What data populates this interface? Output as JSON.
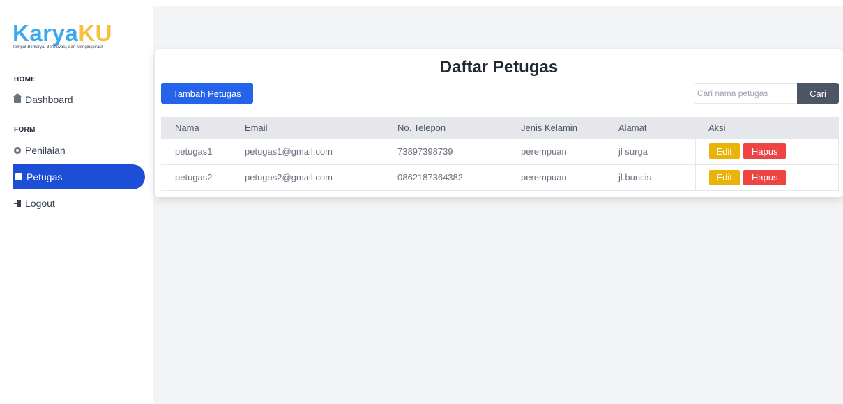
{
  "brand": {
    "name_part1": "Karya",
    "name_part2": "KU",
    "tagline": "Tempat Berkarya, Berinovasi, dan Menginspirasi!"
  },
  "sidebar": {
    "sections": [
      {
        "label": "HOME",
        "items": [
          {
            "label": "Dashboard",
            "icon": "home-icon"
          }
        ]
      },
      {
        "label": "FORM",
        "items": [
          {
            "label": "Penilaian",
            "icon": "gear-icon"
          },
          {
            "label": "Petugas",
            "icon": "document-icon",
            "active": true
          },
          {
            "label": "Logout",
            "icon": "logout-icon"
          }
        ]
      }
    ]
  },
  "page": {
    "title": "Daftar Petugas",
    "add_button": "Tambah Petugas",
    "search": {
      "placeholder": "Cari nama petugas",
      "button": "Cari"
    }
  },
  "table": {
    "columns": [
      "Nama",
      "Email",
      "No. Telepon",
      "Jenis Kelamin",
      "Alamat",
      "Aksi"
    ],
    "rows": [
      {
        "nama": "petugas1",
        "email": "petugas1@gmail.com",
        "telepon": "73897398739",
        "jenis_kelamin": "perempuan",
        "alamat": "jl surga"
      },
      {
        "nama": "petugas2",
        "email": "petugas2@gmail.com",
        "telepon": "0862187364382",
        "jenis_kelamin": "perempuan",
        "alamat": "jl.buncis"
      }
    ],
    "edit_label": "Edit",
    "delete_label": "Hapus"
  },
  "colors": {
    "primary": "#1d4ed8",
    "logo_blue": "#3aa9f0",
    "logo_yellow": "#f6c043",
    "edit": "#eab308",
    "delete": "#ef4444",
    "search_button": "#4b5563"
  }
}
